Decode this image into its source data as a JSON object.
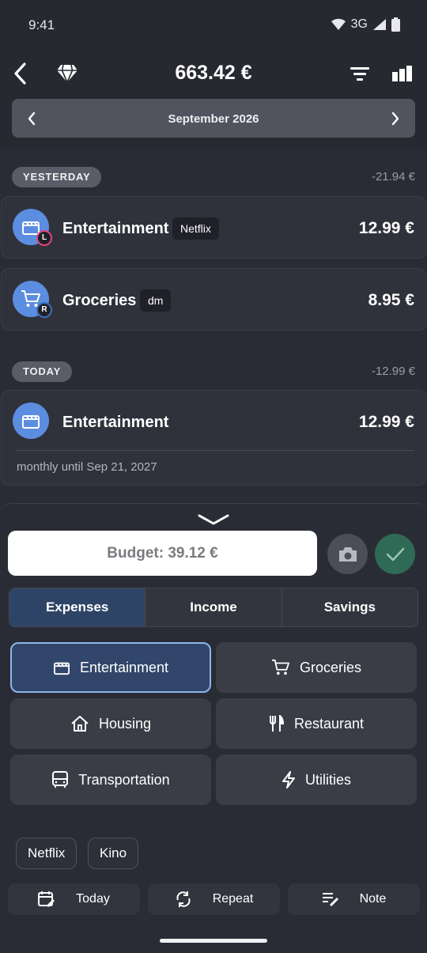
{
  "status_bar": {
    "time": "9:41",
    "network": "3G"
  },
  "appbar": {
    "total": "663.42 €",
    "back_icon": "back-arrow-icon",
    "diamond_icon": "diamond-icon",
    "filter_icon": "filter-icon",
    "stats_icon": "bar-chart-icon"
  },
  "month": {
    "label": "September 2026"
  },
  "days": [
    {
      "label": "YESTERDAY",
      "total": "-21.94 €",
      "transactions": [
        {
          "category": "Entertainment",
          "tag": "Netflix",
          "amount": "12.99 €",
          "badge": "L",
          "badge_color": "#e0457b",
          "icon": "clapperboard-icon"
        },
        {
          "category": "Groceries",
          "tag": "dm",
          "amount": "8.95 €",
          "badge": "R",
          "badge_color": "#3a6fb8",
          "icon": "cart-icon"
        }
      ]
    },
    {
      "label": "TODAY",
      "total": "-12.99 €",
      "transactions": [
        {
          "category": "Entertainment",
          "amount": "12.99 €",
          "recurring": "monthly until Sep 21, 2027",
          "icon": "clapperboard-icon"
        }
      ]
    }
  ],
  "sheet": {
    "budget": "Budget: 39.12 €",
    "tabs": [
      "Expenses",
      "Income",
      "Savings"
    ],
    "active_tab": "Expenses",
    "categories": [
      {
        "label": "Entertainment",
        "icon": "clapperboard-icon",
        "selected": true
      },
      {
        "label": "Groceries",
        "icon": "cart-icon"
      },
      {
        "label": "Housing",
        "icon": "house-icon"
      },
      {
        "label": "Restaurant",
        "icon": "fork-knife-icon"
      },
      {
        "label": "Transportation",
        "icon": "bus-icon"
      },
      {
        "label": "Utilities",
        "icon": "bolt-icon"
      }
    ],
    "tag_suggestions": [
      "Netflix",
      "Kino"
    ],
    "options": [
      {
        "label": "Today",
        "icon": "calendar-edit-icon"
      },
      {
        "label": "Repeat",
        "icon": "repeat-icon"
      },
      {
        "label": "Note",
        "icon": "note-edit-icon"
      }
    ]
  },
  "colors": {
    "accent": "#5b8de0",
    "confirm": "#2f6a56",
    "selected_border": "#8fb4ec",
    "background": "#2a2c35"
  }
}
